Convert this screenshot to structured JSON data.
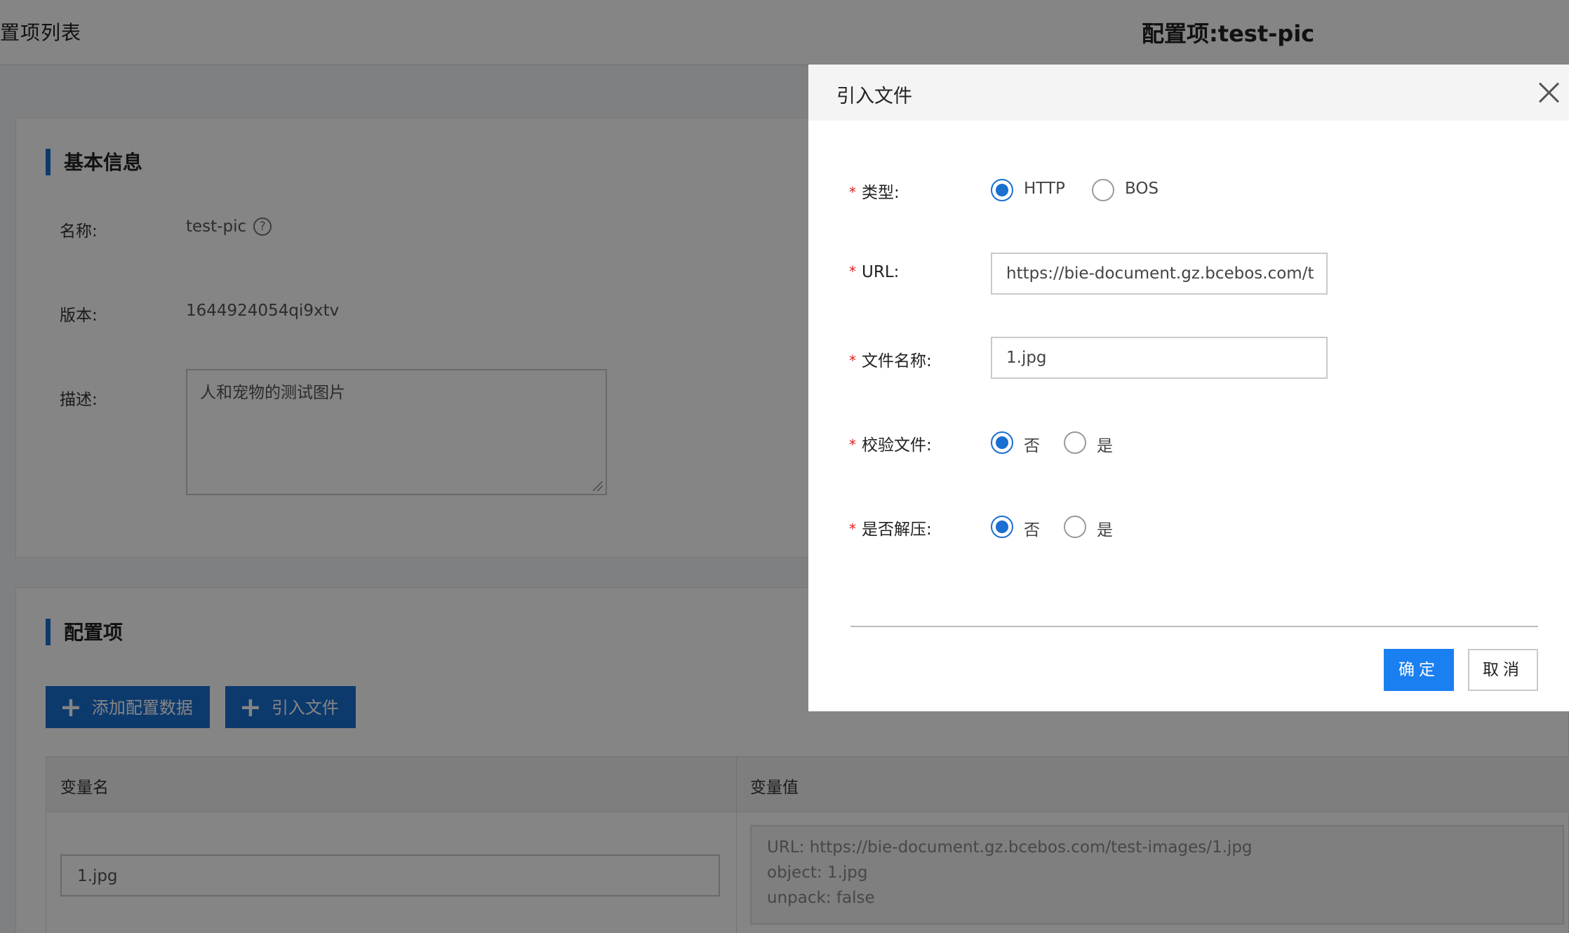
{
  "header": {
    "breadcrumb": "置项列表",
    "title": "配置项:test-pic"
  },
  "basic_info": {
    "section_title": "基本信息",
    "name_label": "名称:",
    "name_value": "test-pic",
    "help_glyph": "?",
    "version_label": "版本:",
    "version_value": "1644924054qi9xtv",
    "desc_label": "描述:",
    "desc_value": "人和宠物的测试图片"
  },
  "config": {
    "section_title": "配置项",
    "add_button": "添加配置数据",
    "import_button": "引入文件",
    "plus_glyph": "+",
    "columns": [
      "变量名",
      "变量值"
    ],
    "rows": [
      {
        "name": "1.jpg",
        "value_lines": [
          "URL: https://bie-document.gz.bcebos.com/test-images/1.jpg",
          "object: 1.jpg",
          "unpack: false"
        ]
      }
    ]
  },
  "modal": {
    "title": "引入文件",
    "required_mark": "*",
    "type_label": "类型:",
    "type_options": [
      "HTTP",
      "BOS"
    ],
    "type_selected": "HTTP",
    "url_label": "URL:",
    "url_value": "https://bie-document.gz.bcebos.com/t",
    "filename_label": "文件名称:",
    "filename_value": "1.jpg",
    "verify_label": "校验文件:",
    "verify_options": [
      "否",
      "是"
    ],
    "verify_selected": "否",
    "unpack_label": "是否解压:",
    "unpack_options": [
      "否",
      "是"
    ],
    "unpack_selected": "否",
    "ok_button": "确定",
    "cancel_button": "取消"
  }
}
